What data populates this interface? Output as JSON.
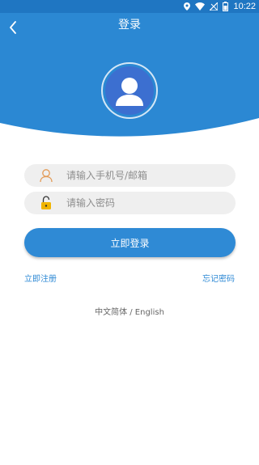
{
  "status_bar": {
    "time": "10:22"
  },
  "header": {
    "title": "登录"
  },
  "form": {
    "username_placeholder": "请输入手机号/邮箱",
    "password_placeholder": "请输入密码",
    "login_label": "立即登录"
  },
  "links": {
    "register": "立即注册",
    "forgot": "忘记密码"
  },
  "language": "中文简体 / English",
  "colors": {
    "primary": "#2b88d3",
    "status_bar": "#1f76c2",
    "avatar": "#3c6fd0",
    "user_icon": "#e39a55",
    "lock_icon": "#f0b400"
  }
}
